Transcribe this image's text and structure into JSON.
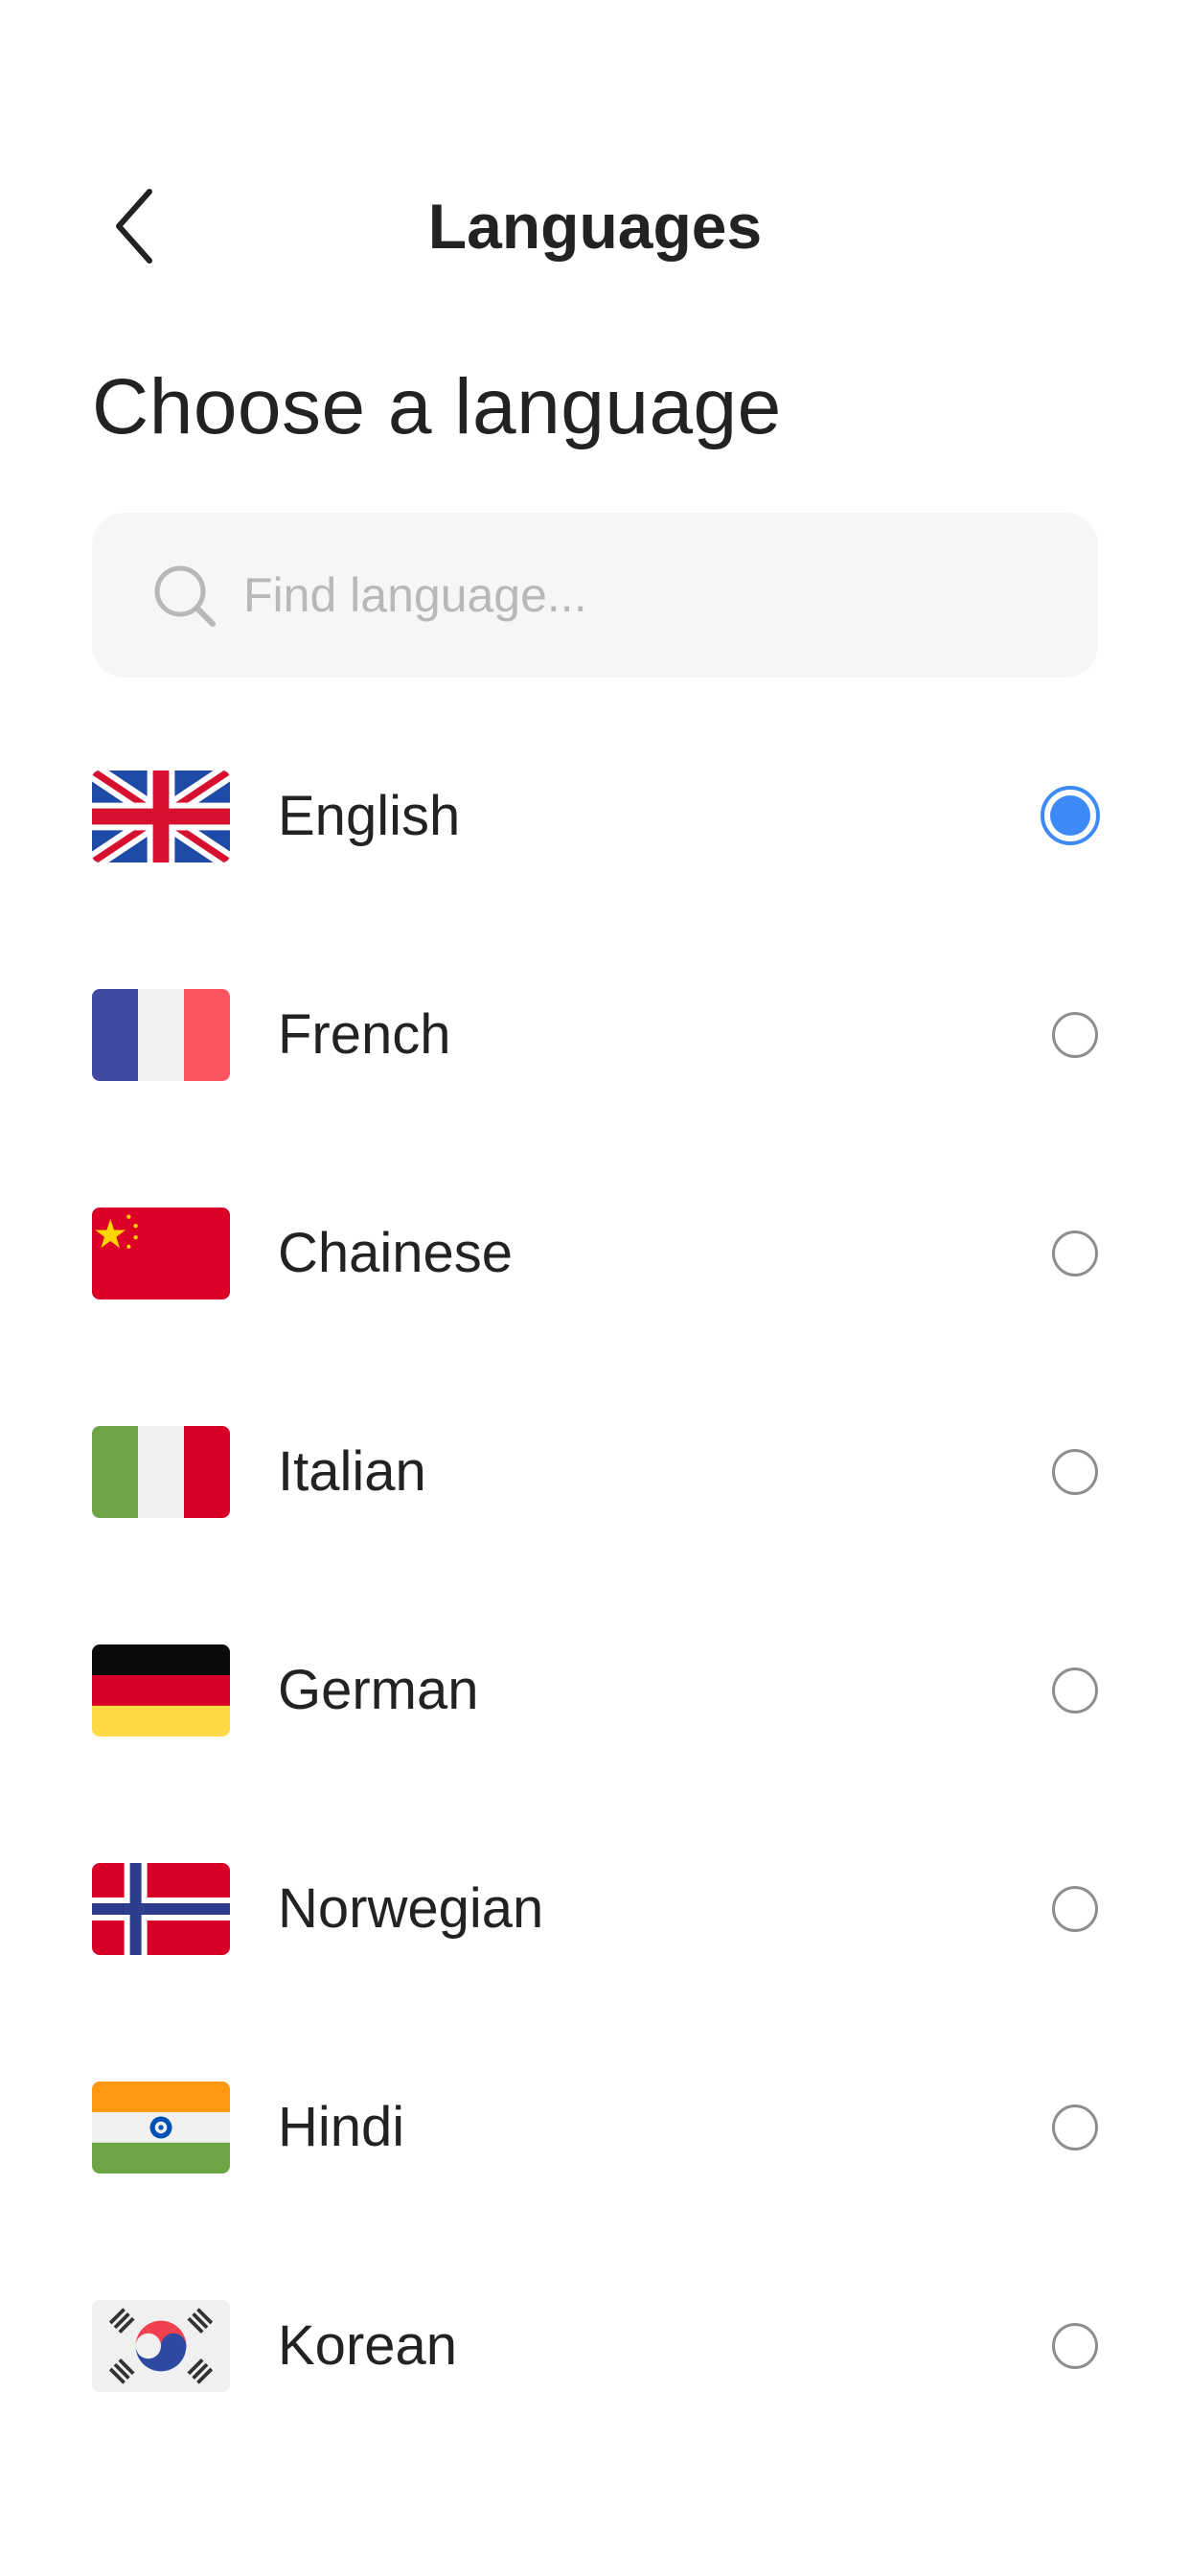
{
  "header": {
    "title": "Languages",
    "back_icon": "chevron-left-icon"
  },
  "page": {
    "heading": "Choose a language"
  },
  "search": {
    "placeholder": "Find language...",
    "value": "",
    "icon": "search-icon"
  },
  "languages": [
    {
      "label": "English",
      "flag": "uk-flag-icon",
      "selected": true
    },
    {
      "label": "French",
      "flag": "france-flag-icon",
      "selected": false
    },
    {
      "label": "Chainese",
      "flag": "china-flag-icon",
      "selected": false
    },
    {
      "label": "Italian",
      "flag": "italy-flag-icon",
      "selected": false
    },
    {
      "label": "German",
      "flag": "germany-flag-icon",
      "selected": false
    },
    {
      "label": "Norwegian",
      "flag": "norway-flag-icon",
      "selected": false
    },
    {
      "label": "Hindi",
      "flag": "india-flag-icon",
      "selected": false
    },
    {
      "label": "Korean",
      "flag": "korea-flag-icon",
      "selected": false
    }
  ],
  "colors": {
    "accent": "#3d8af7",
    "text": "#222222",
    "placeholder": "#b8b8b8",
    "search_background": "#f6f6f6",
    "radio_border": "#8e8e8e"
  }
}
